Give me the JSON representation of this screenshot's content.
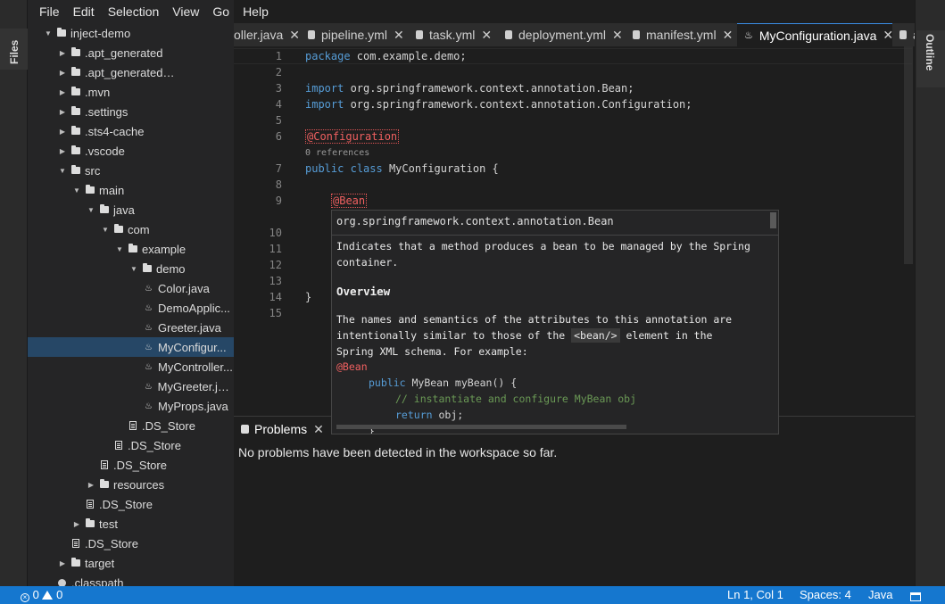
{
  "menu": [
    "File",
    "Edit",
    "Selection",
    "View",
    "Go",
    "Help"
  ],
  "left_strip": {
    "files_label": "Files"
  },
  "right_strip": {
    "outline_label": "Outline"
  },
  "tree": [
    {
      "label": "inject-demo",
      "kind": "folder",
      "open": true
    },
    {
      "label": ".apt_generated",
      "kind": "folder",
      "open": false
    },
    {
      "label": ".apt_generated_tests",
      "kind": "folder",
      "open": false
    },
    {
      "label": ".mvn",
      "kind": "folder",
      "open": false
    },
    {
      "label": ".settings",
      "kind": "folder",
      "open": false
    },
    {
      "label": ".sts4-cache",
      "kind": "folder",
      "open": false
    },
    {
      "label": ".vscode",
      "kind": "folder",
      "open": false
    },
    {
      "label": "src",
      "kind": "folder",
      "open": true
    },
    {
      "label": "main",
      "kind": "folder",
      "open": true
    },
    {
      "label": "java",
      "kind": "folder",
      "open": true
    },
    {
      "label": "com",
      "kind": "folder",
      "open": true
    },
    {
      "label": "example",
      "kind": "folder",
      "open": true
    },
    {
      "label": "demo",
      "kind": "folder",
      "open": true
    },
    {
      "label": "Color.java",
      "kind": "java"
    },
    {
      "label": "DemoApplic...",
      "kind": "java"
    },
    {
      "label": "Greeter.java",
      "kind": "java"
    },
    {
      "label": "MyConfigur...",
      "kind": "java",
      "selected": true
    },
    {
      "label": "MyController...",
      "kind": "java"
    },
    {
      "label": "MyGreeter.java",
      "kind": "java"
    },
    {
      "label": "MyProps.java",
      "kind": "java"
    },
    {
      "label": ".DS_Store",
      "kind": "file"
    },
    {
      "label": ".DS_Store",
      "kind": "file"
    },
    {
      "label": ".DS_Store",
      "kind": "file"
    },
    {
      "label": "resources",
      "kind": "folder",
      "open": false
    },
    {
      "label": ".DS_Store",
      "kind": "file"
    },
    {
      "label": "test",
      "kind": "folder",
      "open": false
    },
    {
      "label": ".DS_Store",
      "kind": "file"
    },
    {
      "label": "target",
      "kind": "folder",
      "open": false
    },
    {
      "label": ".classpath",
      "kind": "dot"
    }
  ],
  "tabs": [
    {
      "label": "oller.java",
      "icon": "none"
    },
    {
      "label": "pipeline.yml",
      "icon": "doc"
    },
    {
      "label": "task.yml",
      "icon": "doc"
    },
    {
      "label": "deployment.yml",
      "icon": "doc"
    },
    {
      "label": "manifest.yml",
      "icon": "doc"
    },
    {
      "label": "MyConfiguration.java",
      "icon": "java",
      "active": true
    },
    {
      "label": "a",
      "icon": "doc"
    }
  ],
  "tab_close_glyph": "✕",
  "editor": {
    "line_numbers": [
      "1",
      "2",
      "3",
      "4",
      "5",
      "6",
      "7",
      "8",
      "9",
      "10",
      "11",
      "12",
      "13",
      "14",
      "15"
    ],
    "line_package": "package",
    "line1_rest": " com.example.demo;",
    "import_kw": "import",
    "line3_rest": " org.springframework.context.annotation.Bean;",
    "line4_rest": " org.springframework.context.annotation.Configuration;",
    "line6_annotation": "@Configuration",
    "code_lens": "0 references",
    "line7_public": "public",
    "line7_class": "class",
    "line7_rest": " MyConfiguration {",
    "line9_annotation": "@Bean",
    "line14": "}"
  },
  "hover": {
    "signature": "org.springframework.context.annotation.Bean",
    "desc_line1": "Indicates that a method produces a bean to be managed by the Spring",
    "desc_line2": "container.",
    "overview_heading": "Overview",
    "para_line1": "The names and semantics of the attributes to this annotation are",
    "para_line2_a": "intentionally similar to those of the ",
    "para_line2_tag": "<bean/>",
    "para_line2_b": " element in the",
    "para_line3": "Spring XML schema. For example:",
    "code_annotation": "@Bean",
    "code_public": "public",
    "code_sig_rest": " MyBean myBean() {",
    "code_comment": "// instantiate and configure MyBean obj",
    "code_return": "return",
    "code_return_rest": " obj;",
    "code_closing": "}"
  },
  "panel": {
    "tab_label": "Problems",
    "message": "No problems have been detected in the workspace so far."
  },
  "status": {
    "errors": "0",
    "warnings": "0",
    "position": "Ln 1, Col 1",
    "spaces": "Spaces: 4",
    "language": "Java"
  },
  "colors": {
    "accent": "#1577cf",
    "keyword": "#569cd6",
    "annotation": "#f06060",
    "comment": "#6a9955",
    "selection": "#264766"
  }
}
